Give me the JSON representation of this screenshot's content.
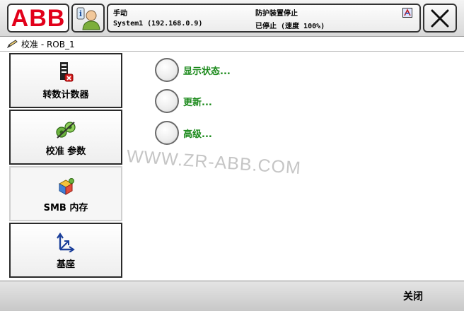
{
  "topbar": {
    "logo_text": "ABB",
    "status": {
      "mode": "手动",
      "system": "System1 (192.168.0.9)",
      "safety": "防护装置停止",
      "run_state": "已停止 (速度 100%)"
    }
  },
  "title": "校准 - ROB_1",
  "nav": [
    {
      "label": "转数计数器",
      "icon": "revolution-counter-icon"
    },
    {
      "label": "校准 参数",
      "icon": "calibration-parameters-icon"
    },
    {
      "label": "SMB 内存",
      "icon": "smb-memory-icon"
    },
    {
      "label": "基座",
      "icon": "base-frame-icon"
    }
  ],
  "options": [
    {
      "label": "显示状态..."
    },
    {
      "label": "更新..."
    },
    {
      "label": "高级..."
    }
  ],
  "watermark": "WWW.ZR-ABB.COM",
  "bottombar": {
    "close_label": "关闭"
  },
  "colors": {
    "option_text": "#1c8a1c",
    "abb_red": "#e2001a"
  }
}
